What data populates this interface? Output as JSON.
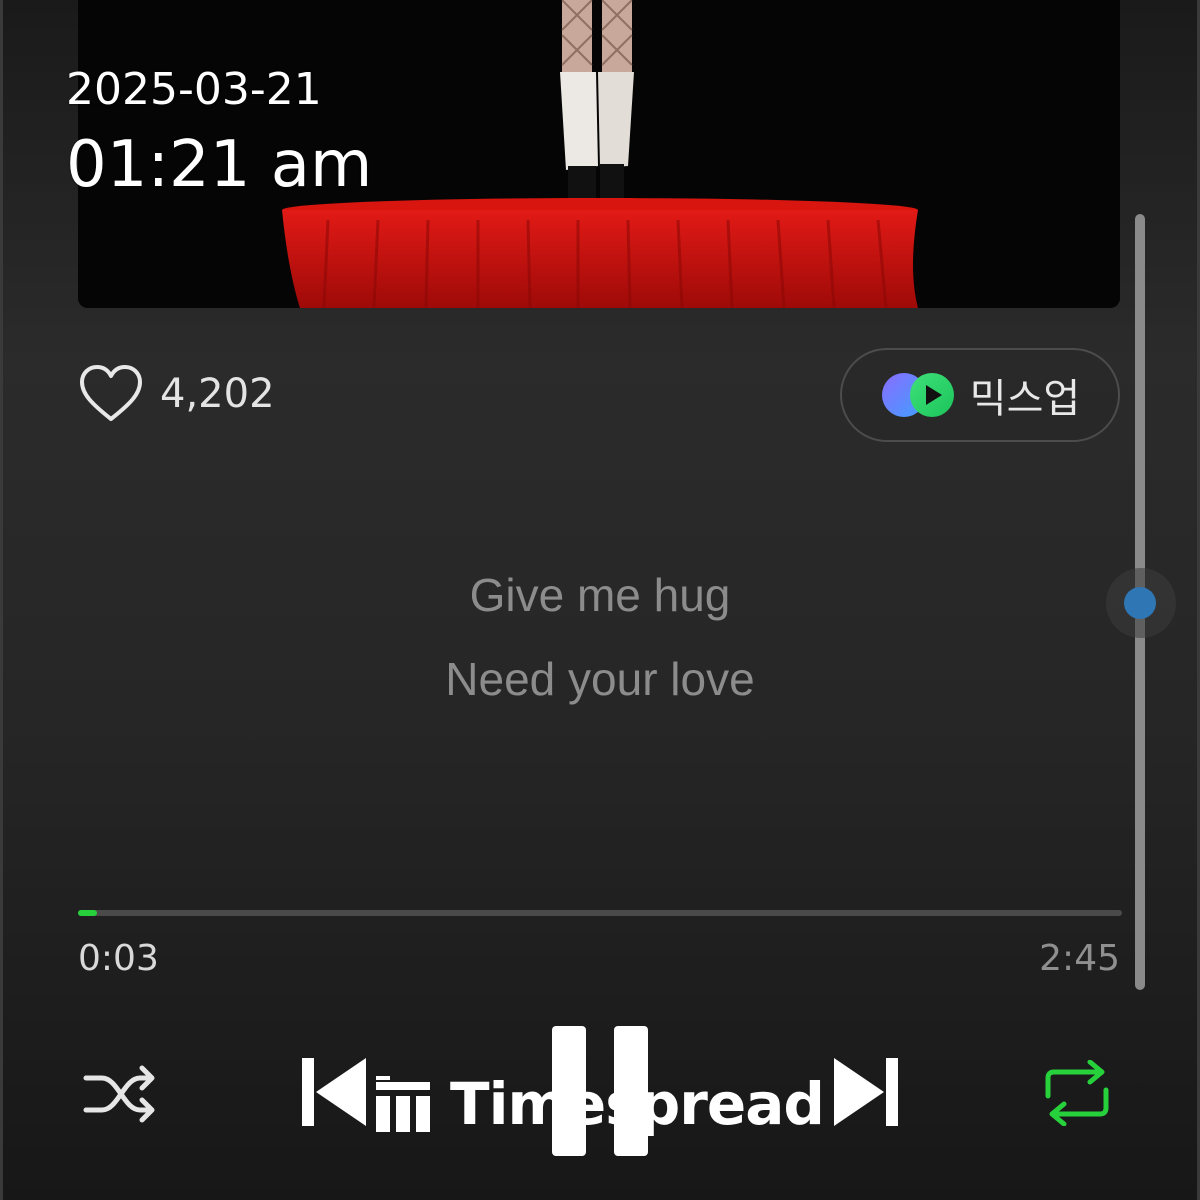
{
  "overlay": {
    "date": "2025-03-21",
    "time": "01:21 am"
  },
  "player": {
    "like_count": "4,202",
    "mixup_label": "믹스업",
    "lyrics": [
      "Give me hug",
      "Need your love"
    ],
    "elapsed": "0:03",
    "duration": "2:45",
    "progress_fraction": 0.018,
    "volume_fraction": 0.5
  },
  "watermark": {
    "text": "Timespread"
  },
  "colors": {
    "accent_green": "#27d13c",
    "volume_thumb": "#2f76b4",
    "curtain_red": "#c8120f"
  },
  "icons": {
    "like": "heart-outline-icon",
    "mixup": "mixup-logo-icon",
    "shuffle": "shuffle-icon",
    "prev": "skip-previous-icon",
    "pause": "pause-icon",
    "next": "skip-next-icon",
    "repeat": "repeat-icon"
  }
}
